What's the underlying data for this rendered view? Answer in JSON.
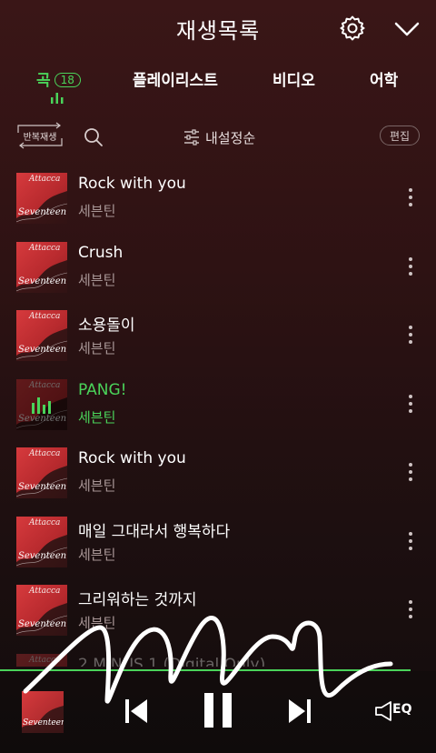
{
  "header": {
    "title": "재생목록",
    "icons": [
      "gear-icon",
      "chevron-down-icon"
    ]
  },
  "tabs": [
    {
      "label": "곡",
      "count": "18",
      "active": true
    },
    {
      "label": "플레이리스트"
    },
    {
      "label": "비디오"
    },
    {
      "label": "어학"
    }
  ],
  "toolbar": {
    "repeat_label": "반복재생",
    "sort_label": "내설정순",
    "edit_label": "편집"
  },
  "colors": {
    "accent": "#4ad35a",
    "cover": "#c93236",
    "background": "#2e1213"
  },
  "songs": [
    {
      "title": "Rock with you",
      "artist": "세븐틴"
    },
    {
      "title": "Crush",
      "artist": "세븐틴"
    },
    {
      "title": "소용돌이",
      "artist": "세븐틴"
    },
    {
      "title": "PANG!",
      "artist": "세븐틴",
      "playing": true
    },
    {
      "title": "Rock with you",
      "artist": "세븐틴"
    },
    {
      "title": "매일 그대라서 행복하다",
      "artist": "세븐틴"
    },
    {
      "title": "그리워하는 것까지",
      "artist": "세븐틴"
    },
    {
      "title": "2 MINUS 1 (Digital Only)"
    }
  ],
  "album": {
    "top_text": "Attacca",
    "bottom_text": "Seventeen"
  },
  "player": {
    "eq_label": "EQ",
    "icons": [
      "previous-icon",
      "pause-icon",
      "next-icon",
      "eq-icon"
    ]
  }
}
